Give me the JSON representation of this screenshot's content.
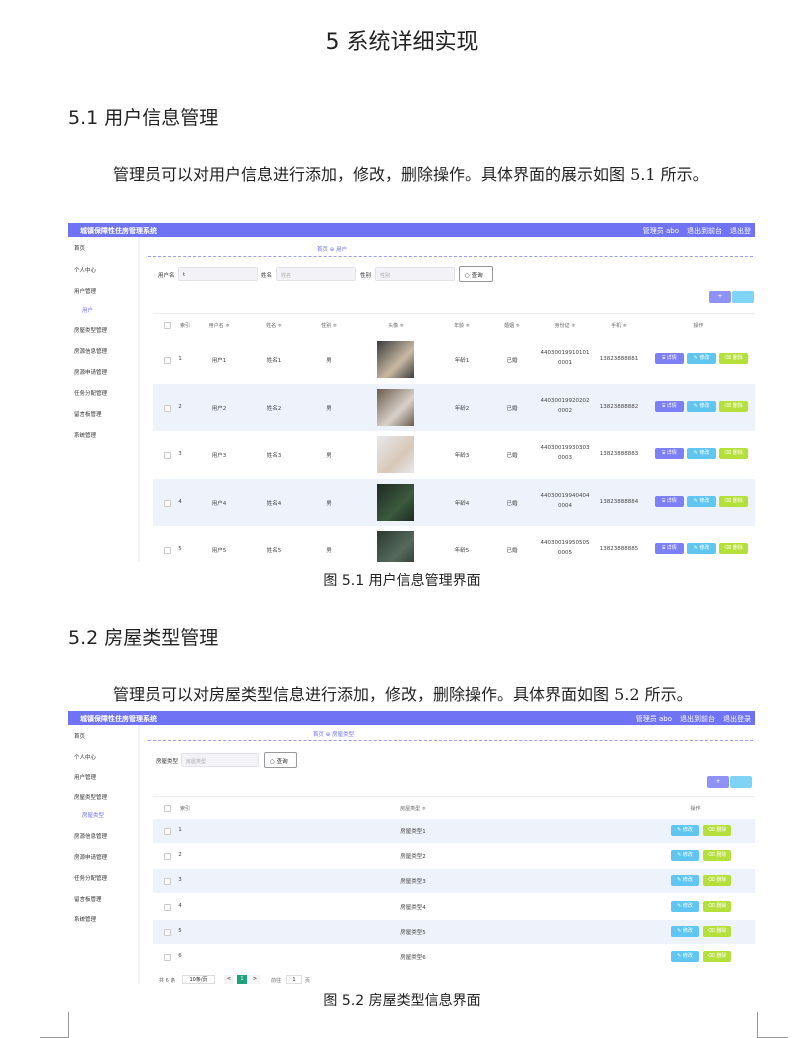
{
  "doc": {
    "h1": "5 系统详细实现",
    "s51": "5.1  用户信息管理",
    "p1": "管理员可以对用户信息进行添加，修改，删除操作。具体界面的展示如图 5.1 所示。",
    "cap1": "图 5.1  用户信息管理界面",
    "s52": "5.2  房屋类型管理",
    "p2": "管理员可以对房屋类型信息进行添加，修改，删除操作。具体界面如图 5.2 所示。",
    "cap2": "图 5.2  房屋类型信息界面"
  },
  "app": {
    "title": "城镇保障性住房管理系统",
    "admin": "管理员 abo",
    "back": "退出到前台",
    "logout": "退出登录",
    "logout_cut": "退出登",
    "plus": "+",
    "menu": [
      "首页",
      "个人中心",
      "用户管理",
      "房屋类型管理",
      "房源信息管理",
      "房源申请管理",
      "任务分配管理",
      "留言板管理",
      "系统管理"
    ],
    "search_label": "查询"
  },
  "shot1": {
    "crumb": "首页 ⊕ 用户",
    "sub_item": "用户",
    "f_user_label": "用户名",
    "f_user_value": "t",
    "f_name_label": "姓名",
    "f_name_ph": "姓名",
    "f_sex_label": "性别",
    "f_sex_ph": "性别",
    "cols": [
      "索引",
      "用户名 ≑",
      "姓名 ≑",
      "性别 ≑",
      "头像 ≑",
      "年龄 ≑",
      "婚姻 ≑",
      "身份证 ≑",
      "手机 ≑",
      "操作"
    ],
    "btn_detail": "⌸ 详情",
    "btn_edit": "✎ 修改",
    "btn_del": "⌫ 删除",
    "rows": [
      {
        "idx": "1",
        "user": "用户1",
        "name": "姓名1",
        "sex": "男",
        "age": "年龄1",
        "mar": "已婚",
        "id1": "44030019910101",
        "id2": "0001",
        "phone": "13823888881"
      },
      {
        "idx": "2",
        "user": "用户2",
        "name": "姓名2",
        "sex": "男",
        "age": "年龄2",
        "mar": "已婚",
        "id1": "44030019920202",
        "id2": "0002",
        "phone": "13823888882"
      },
      {
        "idx": "3",
        "user": "用户3",
        "name": "姓名3",
        "sex": "男",
        "age": "年龄3",
        "mar": "已婚",
        "id1": "44030019930303",
        "id2": "0003",
        "phone": "13823888883"
      },
      {
        "idx": "4",
        "user": "用户4",
        "name": "姓名4",
        "sex": "男",
        "age": "年龄4",
        "mar": "已婚",
        "id1": "44030019940404",
        "id2": "0004",
        "phone": "13823888884"
      },
      {
        "idx": "5",
        "user": "用户5",
        "name": "姓名5",
        "sex": "男",
        "age": "年龄5",
        "mar": "已婚",
        "id1": "44030019950505",
        "id2": "0005",
        "phone": "13823888885"
      }
    ]
  },
  "shot2": {
    "crumb": "首页 ⊕ 房屋类型",
    "sub_item": "房屋类型",
    "f_label": "房屋类型",
    "f_ph": "房屋类型",
    "cols": [
      "索引",
      "房屋类型 ≑",
      "操作"
    ],
    "btn_edit": "✎ 修改",
    "btn_del": "⌫ 删除",
    "rows": [
      {
        "idx": "1",
        "type": "房屋类型1"
      },
      {
        "idx": "2",
        "type": "房屋类型2"
      },
      {
        "idx": "3",
        "type": "房屋类型3"
      },
      {
        "idx": "4",
        "type": "房屋类型4"
      },
      {
        "idx": "5",
        "type": "房屋类型5"
      },
      {
        "idx": "6",
        "type": "房屋类型6"
      }
    ],
    "pager": {
      "total": "共 6 条",
      "size": "10条/页",
      "prev": "<",
      "page": "1",
      "next": ">",
      "goto": "前往",
      "goto_val": "1",
      "unit": "页"
    }
  }
}
